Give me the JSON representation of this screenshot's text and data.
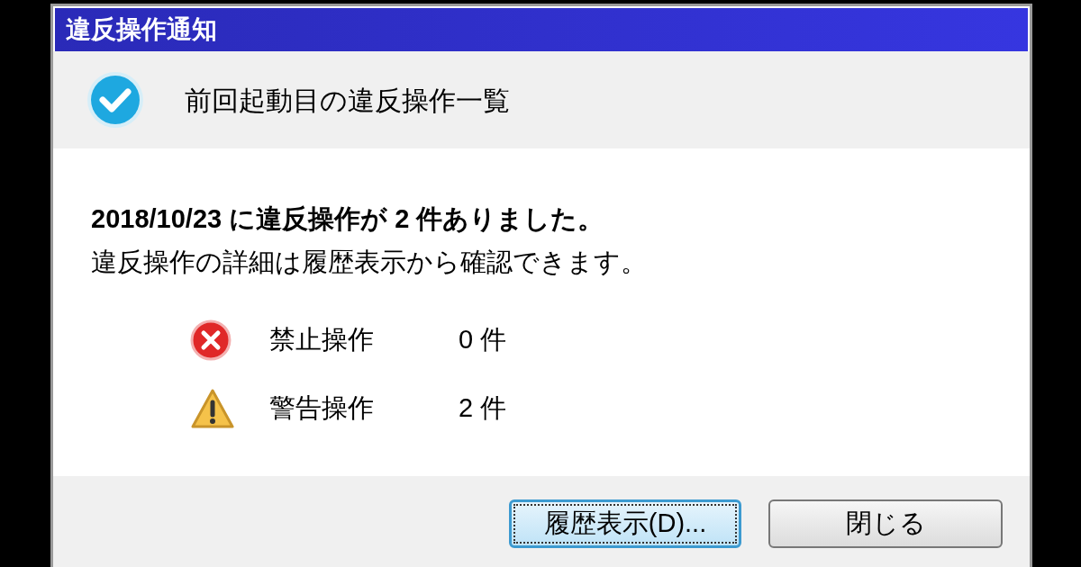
{
  "window": {
    "title": "違反操作通知"
  },
  "header": {
    "text": "前回起動目の違反操作一覧"
  },
  "message": {
    "summary": "2018/10/23 に違反操作が 2 件ありました。",
    "detail": "違反操作の詳細は履歴表示から確認できます。"
  },
  "counts": [
    {
      "kind": "error",
      "label": "禁止操作",
      "count": "0 件"
    },
    {
      "kind": "warning",
      "label": "警告操作",
      "count": "2 件"
    }
  ],
  "buttons": [
    {
      "label": "履歴表示(D)...",
      "focused": true
    },
    {
      "label": "閉じる",
      "focused": false
    }
  ]
}
